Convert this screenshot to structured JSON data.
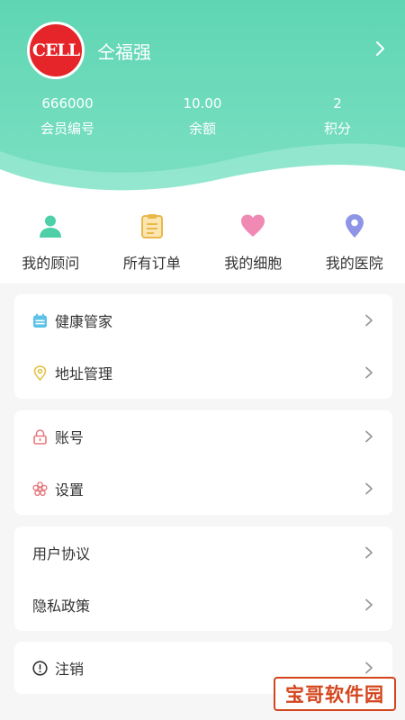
{
  "profile": {
    "avatar_text": "CELL",
    "username": "仝福强"
  },
  "stats": [
    {
      "value": "666000",
      "label": "会员编号"
    },
    {
      "value": "10.00",
      "label": "余额"
    },
    {
      "value": "2",
      "label": "积分"
    }
  ],
  "quick_actions": [
    {
      "label": "我的顾问",
      "icon": "person-icon",
      "color": "#4ecfa8"
    },
    {
      "label": "所有订单",
      "icon": "clipboard-icon",
      "color": "#e9b84a"
    },
    {
      "label": "我的细胞",
      "icon": "heart-icon",
      "color": "#f08ab4"
    },
    {
      "label": "我的医院",
      "icon": "location-pin-icon",
      "color": "#8e95e6"
    }
  ],
  "menu": {
    "health_manager": "健康管家",
    "address_management": "地址管理",
    "account": "账号",
    "settings": "设置",
    "user_agreement": "用户协议",
    "privacy_policy": "隐私政策",
    "cancel_account": "注销"
  },
  "watermark": "宝哥软件园",
  "colors": {
    "header_green": "#5fd6b3",
    "background": "#f6f6f7",
    "card": "#ffffff",
    "text": "#333333",
    "arrow": "#999999"
  }
}
